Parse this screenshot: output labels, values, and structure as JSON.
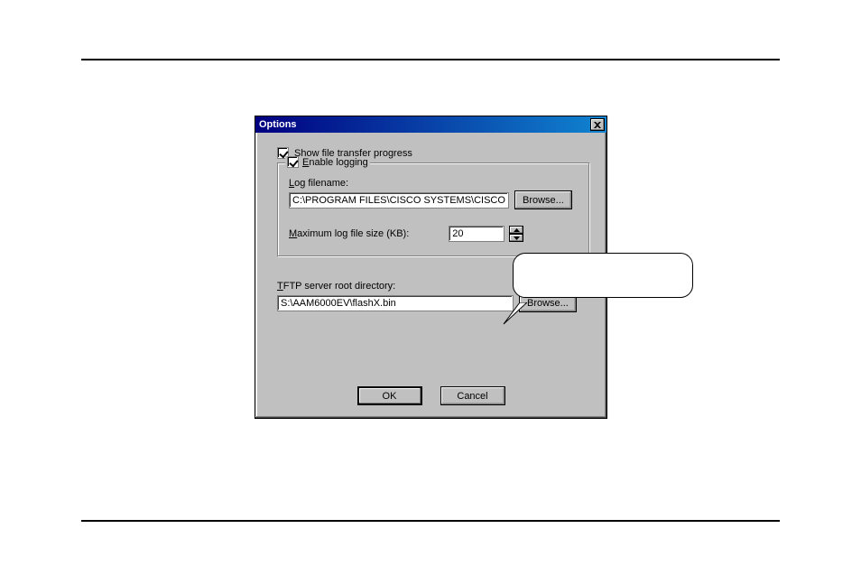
{
  "dialog": {
    "title": "Options",
    "show_progress_label_pre": "S",
    "show_progress_label_post": "how file transfer progress",
    "enable_logging_label_pre": "E",
    "enable_logging_label_post": "nable logging",
    "log_filename_label_pre": "L",
    "log_filename_label_post": "og filename:",
    "log_filename_value": "C:\\PROGRAM FILES\\CISCO SYSTEMS\\CISCO TFTP",
    "browse1": "Browse...",
    "max_label_pre": "M",
    "max_label_post": "aximum log file size (KB):",
    "max_value": "20",
    "root_label_pre": "T",
    "root_label_post": "FTP server root directory:",
    "root_value": "S:\\AAM6000EV\\flashX.bin",
    "browse2": "Browse...",
    "ok": "OK",
    "cancel": "Cancel"
  }
}
